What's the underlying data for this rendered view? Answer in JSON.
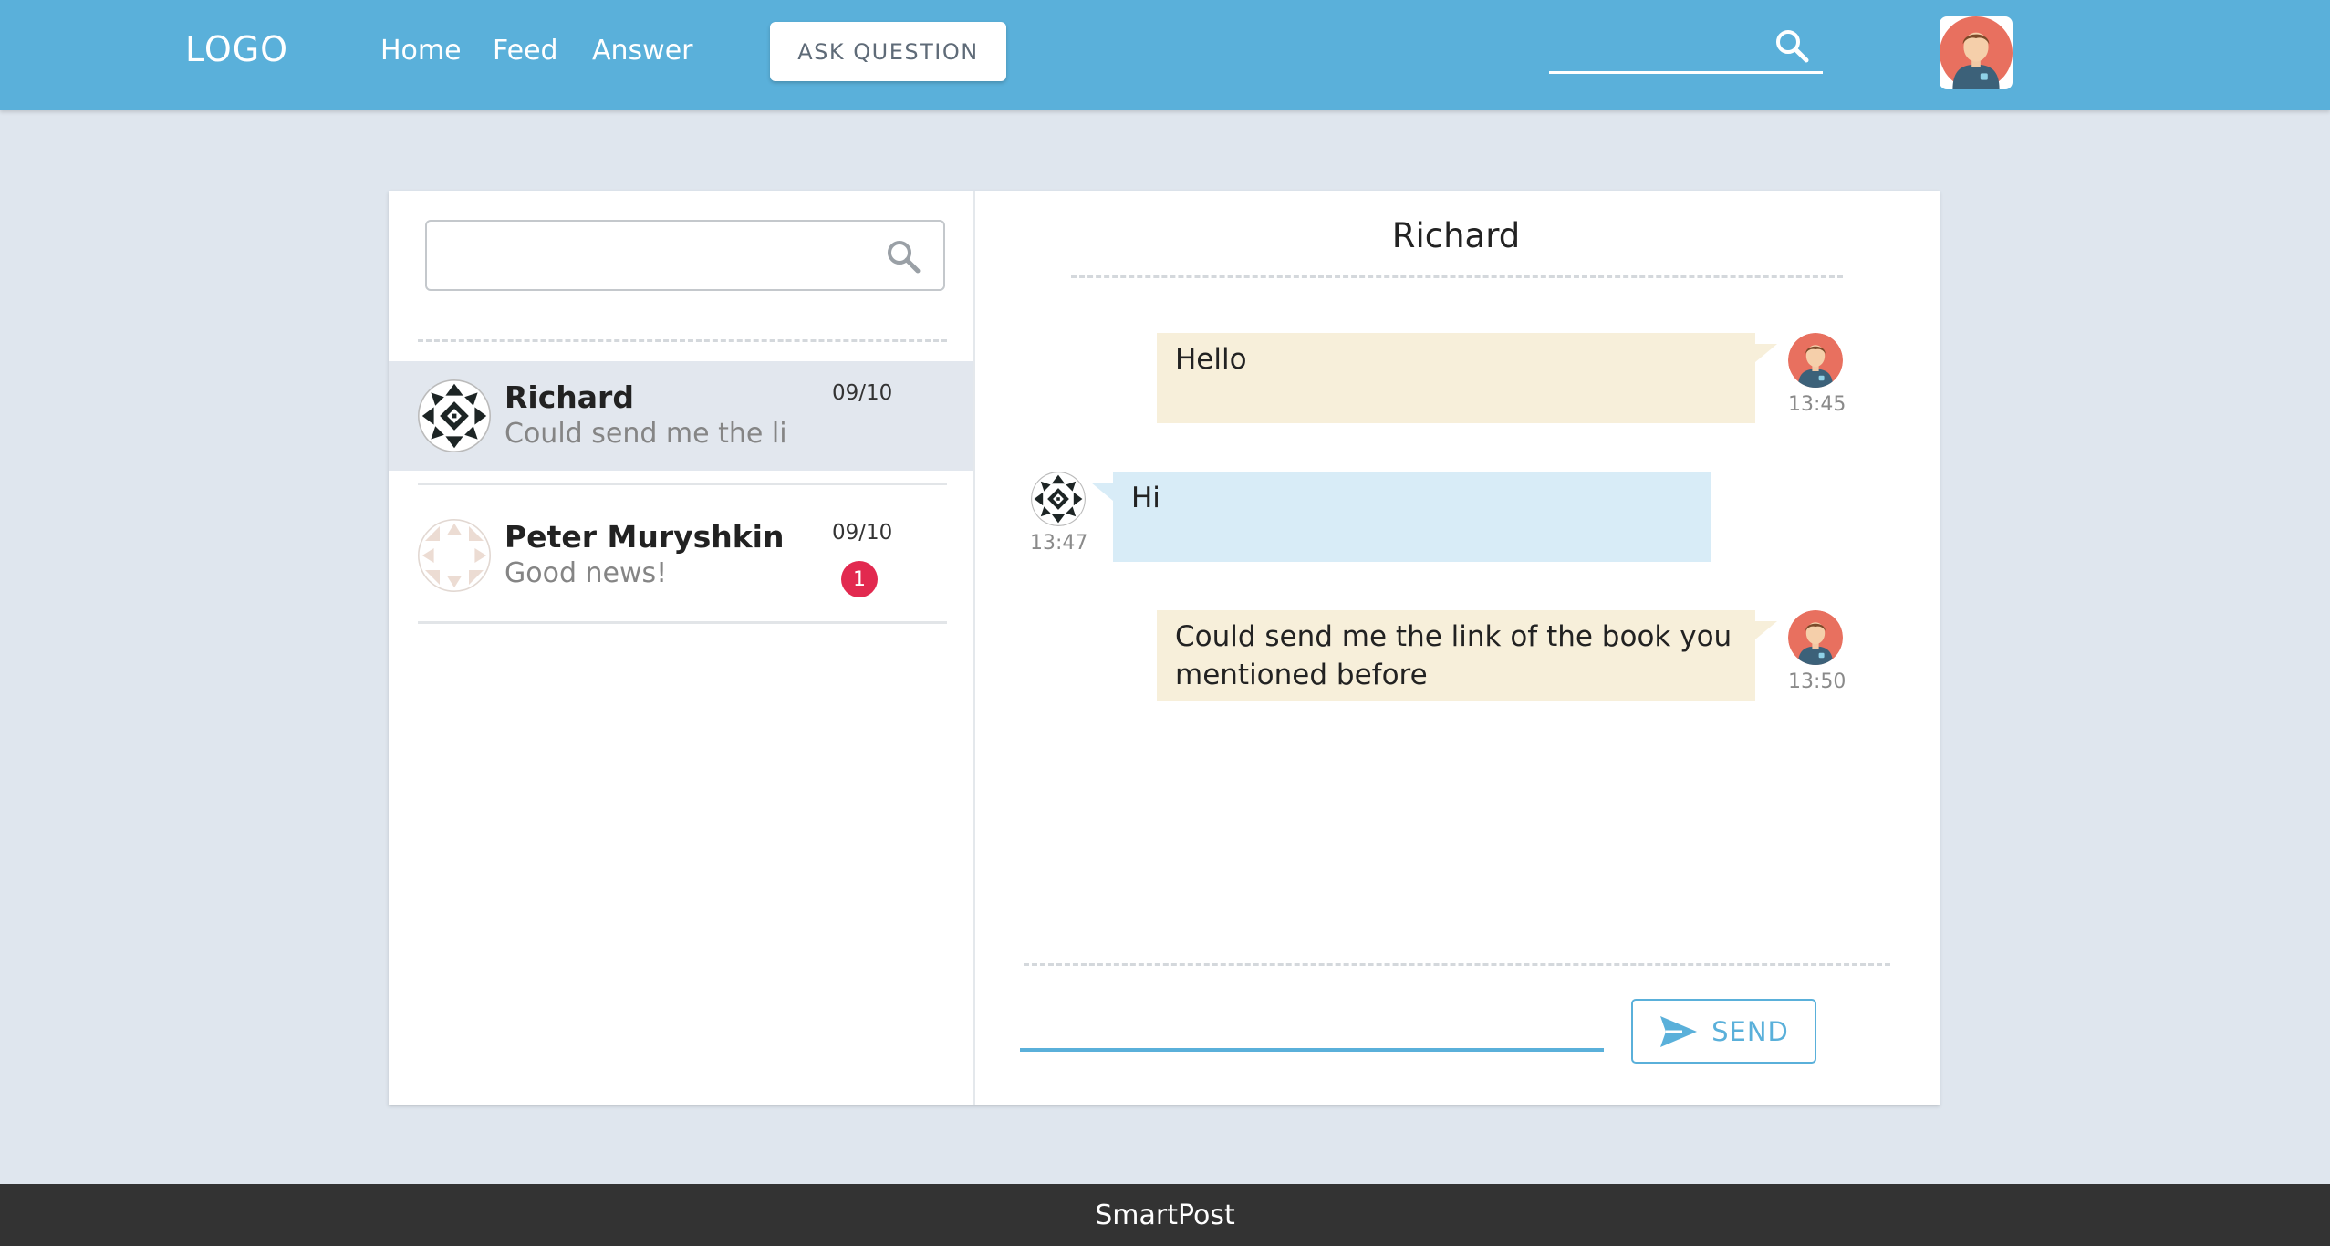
{
  "header": {
    "logo": "LOGO",
    "nav": [
      "Home",
      "Feed",
      "Answer"
    ],
    "ask_button": "ASK QUESTION",
    "search_placeholder": "",
    "brand_color": "#5ab0da"
  },
  "sidebar": {
    "search_placeholder": "",
    "conversations": [
      {
        "name": "Richard",
        "preview": "Could send me the li...",
        "date": "09/10",
        "active": true
      },
      {
        "name": "Peter Muryshkin",
        "preview": "Good news!",
        "date": "09/10",
        "unread": "1"
      }
    ]
  },
  "chat": {
    "title": "Richard",
    "messages": [
      {
        "direction": "outgoing",
        "text": "Hello",
        "time": "13:45"
      },
      {
        "direction": "incoming",
        "text": "Hi",
        "time": "13:47"
      },
      {
        "direction": "outgoing",
        "text": "Could send me the link of the book you mentioned before",
        "time": "13:50"
      }
    ],
    "input_value": "",
    "send_label": "SEND"
  },
  "footer": {
    "text": "SmartPost"
  },
  "icons": {
    "search": "search-icon",
    "send": "send-icon",
    "user_avatar": "user-avatar-icon",
    "identicon": "identicon-icon"
  }
}
